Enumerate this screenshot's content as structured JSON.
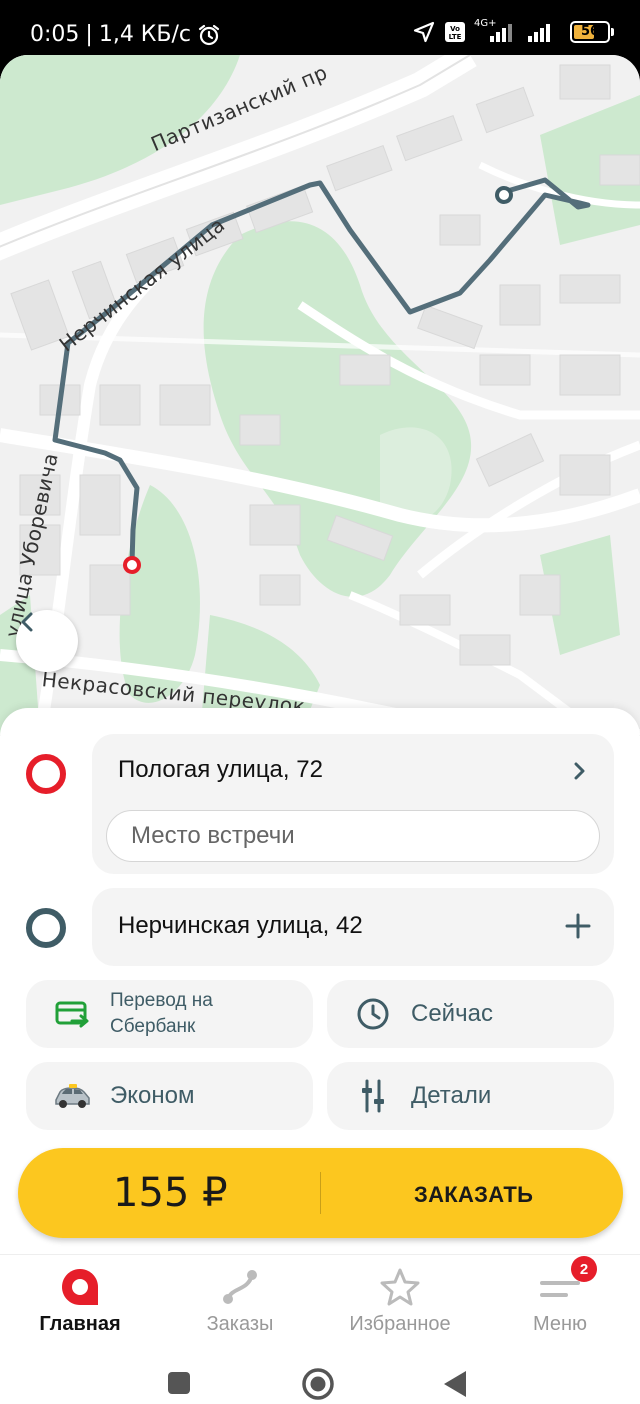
{
  "status_bar": {
    "time": "0:05",
    "separator": "|",
    "speed": "1,4 КБ/с",
    "network": "4G+",
    "volte": "Vo LTE",
    "battery": "56"
  },
  "map": {
    "streets": {
      "partizansky": "Партизанский пр",
      "nerchinskaya": "Нерчинская улица",
      "uborevicha": "улица Уборевича",
      "nekrasovsky": "Некрасовский переулок"
    }
  },
  "route": {
    "from_address": "Пологая улица, 72",
    "meeting_point_placeholder": "Место встречи",
    "to_address": "Нерчинская улица, 42"
  },
  "options": {
    "payment": "Перевод на Сбербанк",
    "time": "Сейчас",
    "tariff": "Эконом",
    "details": "Детали"
  },
  "order": {
    "price": "155 ₽",
    "button_label": "ЗАКАЗАТЬ"
  },
  "bottom_nav": {
    "items": [
      {
        "label": "Главная",
        "active": true
      },
      {
        "label": "Заказы",
        "active": false
      },
      {
        "label": "Избранное",
        "active": false
      },
      {
        "label": "Меню",
        "active": false
      }
    ],
    "menu_badge": "2"
  },
  "colors": {
    "accent_yellow": "#fcc71f",
    "from_red": "#e61e2a",
    "to_slate": "#3f5c66",
    "route_line": "#546e7a",
    "park_green": "#cde9cf"
  }
}
